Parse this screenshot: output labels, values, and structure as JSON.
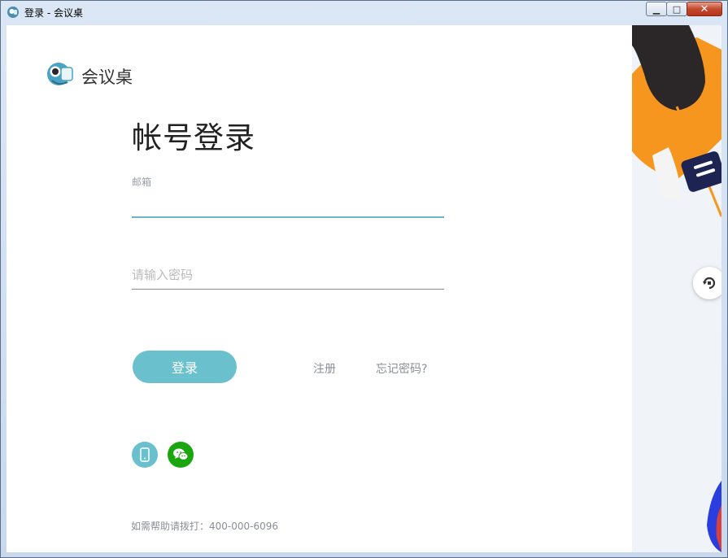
{
  "window": {
    "title": "登录 - 会议桌",
    "minimize_glyph": "▁",
    "maximize_glyph": "□",
    "close_glyph": "✕"
  },
  "brand": {
    "name": "会议桌"
  },
  "form": {
    "title": "帐号登录",
    "email_label": "邮箱",
    "email_value": "",
    "password_placeholder": "请输入密码",
    "login_label": "登录",
    "register_label": "注册",
    "forgot_label": "忘记密码?"
  },
  "social": {
    "phone_icon": "mobile-phone-icon",
    "wechat_icon": "wechat-icon"
  },
  "help": {
    "text": "如需帮助请拨打：400-000-6096"
  },
  "colors": {
    "accent": "#6ac0cd",
    "wechat": "#19a60f",
    "illustration_orange": "#f7961e",
    "illustration_dark": "#2b2627",
    "illustration_navy": "#1e2452"
  }
}
